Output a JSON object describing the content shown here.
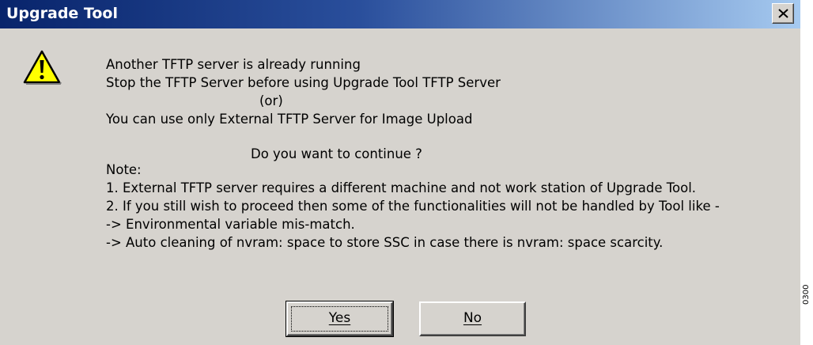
{
  "window": {
    "title": "Upgrade Tool"
  },
  "message": {
    "lines": [
      "Another TFTP server is already running",
      "Stop the TFTP Server before using Upgrade Tool TFTP Server",
      "(or)",
      "You can use only External TFTP Server for Image Upload"
    ],
    "question": "Do you want to continue ?",
    "note_label": "Note:",
    "notes": [
      "1. External TFTP server requires a different machine and not work station of Upgrade Tool.",
      "2. If you still wish to proceed then some of the functionalities will not be handled by Tool like -",
      "-> Environmental variable mis-match.",
      "-> Auto cleaning of nvram: space to store SSC in case there is nvram: space scarcity."
    ]
  },
  "buttons": {
    "yes": "Yes",
    "no": "No"
  },
  "figure_id": "0300",
  "icons": {
    "dialog_icon": "warning-icon",
    "close": "close-icon"
  },
  "colors": {
    "title_bar_start": "#08246b",
    "title_bar_end": "#a6caf0",
    "dialog_face": "#d6d3ce",
    "warning_fill": "#ffff00"
  }
}
